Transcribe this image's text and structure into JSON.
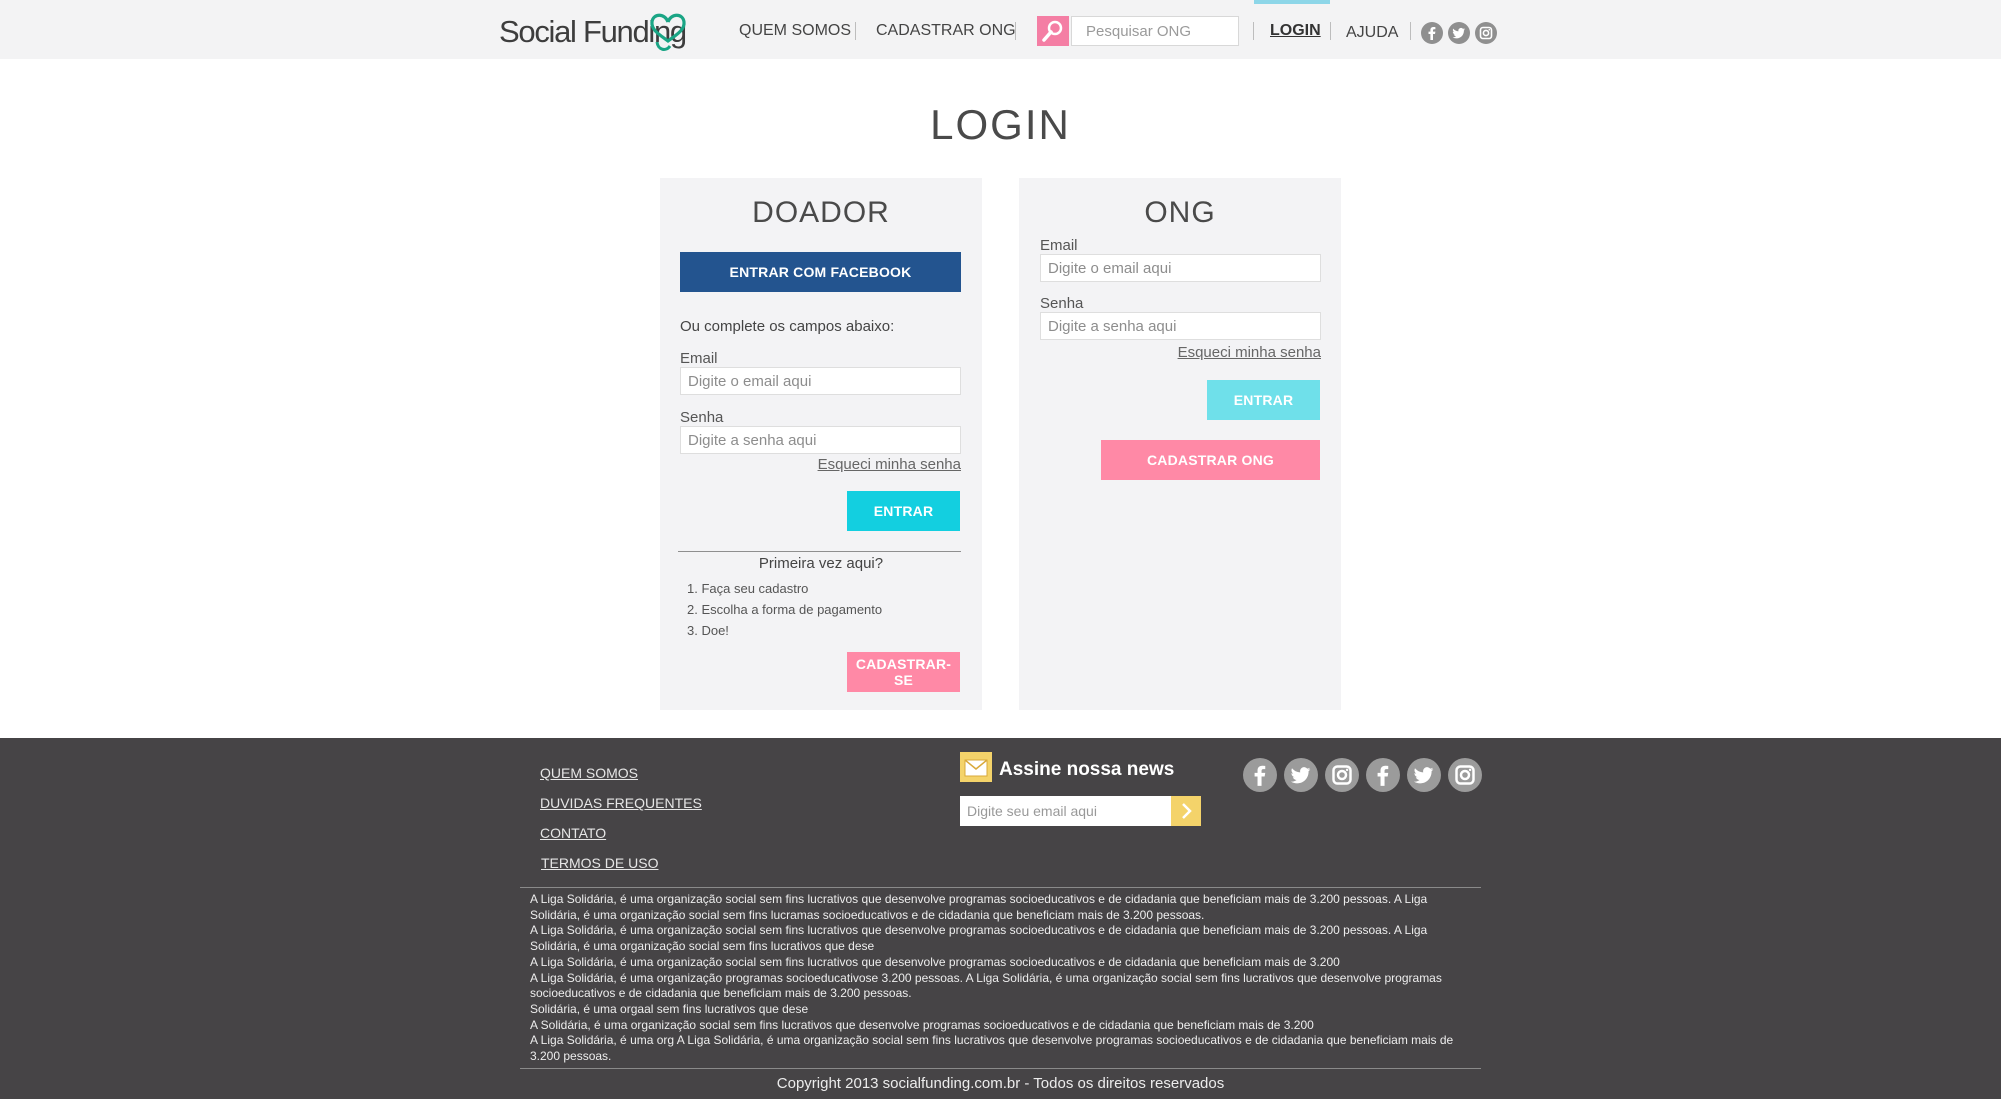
{
  "header": {
    "logo_text": "Social Funding",
    "nav": {
      "quem_somos": "QUEM SOMOS",
      "cadastrar_ong": "CADASTRAR ONG",
      "login": "LOGIN",
      "ajuda": "AJUDA"
    },
    "search": {
      "placeholder": "Pesquisar ONG",
      "icon": "search-icon"
    },
    "social_icons": [
      "facebook-icon",
      "twitter-icon",
      "instagram-icon"
    ]
  },
  "page": {
    "title": "LOGIN"
  },
  "doador": {
    "title": "DOADOR",
    "facebook_button": "ENTRAR COM FACEBOOK",
    "intro": "Ou complete os campos abaixo:",
    "email_label": "Email",
    "email_placeholder": "Digite o email aqui",
    "password_label": "Senha",
    "password_placeholder": "Digite a senha aqui",
    "forgot": "Esqueci minha senha",
    "enter_button": "ENTRAR",
    "first_time": "Primeira vez aqui?",
    "steps": [
      "1. Faça seu cadastro",
      "2. Escolha a forma de pagamento",
      "3. Doe!"
    ],
    "signup_button": "CADASTRAR-SE"
  },
  "ong": {
    "title": "ONG",
    "email_label": "Email",
    "email_placeholder": "Digite o email aqui",
    "password_label": "Senha",
    "password_placeholder": "Digite a senha aqui",
    "forgot": "Esqueci minha senha",
    "enter_button": "ENTRAR",
    "register_button": "CADASTRAR ONG"
  },
  "footer": {
    "links": [
      "QUEM SOMOS",
      "DUVIDAS FREQUENTES",
      "CONTATO",
      "TERMOS DE USO"
    ],
    "newsletter": {
      "title": "Assine nossa news",
      "placeholder": "Digite seu email aqui"
    },
    "social_icons": [
      "facebook-icon",
      "twitter-icon",
      "instagram-icon",
      "facebook-icon",
      "twitter-icon",
      "instagram-icon"
    ],
    "legal": [
      "A Liga Solidária, é uma organização social sem fins lucrativos que desenvolve programas socioeducativos e de cidadania que beneficiam mais de 3.200 pessoas. A Liga Solidária, é uma organização social sem fins lucramas socioeducativos e de cidadania que beneficiam mais de 3.200 pessoas.",
      "A Liga Solidária, é uma organização social sem fins lucrativos que desenvolve programas socioeducativos e de cidadania que beneficiam mais de 3.200 pessoas. A Liga Solidária, é uma organização social sem fins lucrativos que dese",
      "A Liga Solidária, é uma organização social sem fins lucrativos que desenvolve programas socioeducativos e de cidadania que beneficiam mais de 3.200",
      "A Liga Solidária, é uma organização  programas socioeducativose 3.200 pessoas. A Liga Solidária, é uma organização social sem fins lucrativos que desenvolve programas socioeducativos e de cidadania que beneficiam mais de 3.200 pessoas.",
      "Solidária, é uma orgaal sem fins lucrativos que dese",
      "A Solidária, é uma organização social sem fins lucrativos que desenvolve programas socioeducativos e de cidadania que beneficiam mais de 3.200",
      "A Liga Solidária, é uma org A Liga Solidária, é uma organização social sem fins lucrativos que desenvolve programas socioeducativos e de cidadania que beneficiam mais de 3.200 pessoas."
    ],
    "copyright": "Copyright 2013 socialfunding.com.br - Todos os direitos reservados"
  },
  "colors": {
    "facebook": "#23548f",
    "cyan": "#13cfe0",
    "cyan_light": "#6fe0ea",
    "pink": "#ff89a6",
    "footer_bg": "#464446",
    "newsletter_yellow": "#f4d36a"
  }
}
